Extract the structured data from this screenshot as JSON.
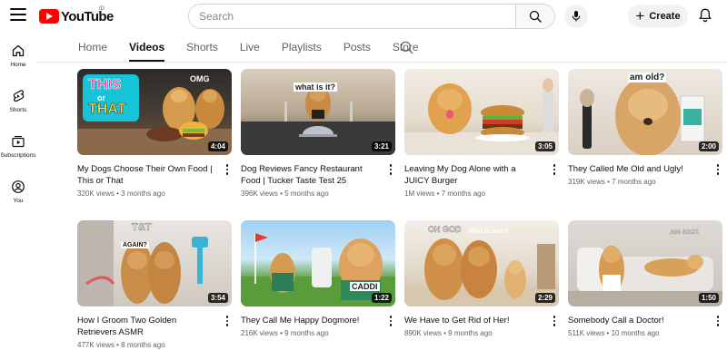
{
  "header": {
    "logo_text": "YouTube",
    "region": "ID",
    "search_placeholder": "Search",
    "create_label": "Create"
  },
  "sidebar": {
    "items": [
      {
        "label": "Home",
        "icon": "home-icon"
      },
      {
        "label": "Shorts",
        "icon": "shorts-icon"
      },
      {
        "label": "Subscriptions",
        "icon": "subscriptions-icon"
      },
      {
        "label": "You",
        "icon": "you-icon"
      }
    ]
  },
  "tabs": [
    "Home",
    "Videos",
    "Shorts",
    "Live",
    "Playlists",
    "Posts",
    "Store"
  ],
  "active_tab": "Videos",
  "videos": [
    {
      "title": "My Dogs Choose Their Own Food | This or That",
      "views": "320K views",
      "age": "3 months ago",
      "duration": "4:04",
      "overlay": [
        "THIS",
        "or",
        "THAT",
        "OMG"
      ]
    },
    {
      "title": "Dog Reviews Fancy Restaurant Food | Tucker Taste Test 25",
      "views": "396K views",
      "age": "5 months ago",
      "duration": "3:21",
      "overlay": [
        "what is it?"
      ]
    },
    {
      "title": "Leaving My Dog Alone with a JUICY Burger",
      "views": "1M views",
      "age": "7 months ago",
      "duration": "3:05",
      "overlay": []
    },
    {
      "title": "They Called Me Old and Ugly!",
      "views": "319K views",
      "age": "7 months ago",
      "duration": "2:00",
      "overlay": [
        "am old?"
      ]
    },
    {
      "title": "How I Groom Two Golden Retrievers ASMR",
      "views": "477K views",
      "age": "8 months ago",
      "duration": "3:54",
      "overlay": [
        "T&T",
        "AGAIN?"
      ]
    },
    {
      "title": "They Call Me Happy Dogmore!",
      "views": "216K views",
      "age": "9 months ago",
      "duration": "1:22",
      "overlay": [
        "CADDI"
      ]
    },
    {
      "title": "We Have to Get Rid of Her!",
      "views": "890K views",
      "age": "9 months ago",
      "duration": "2:29",
      "overlay": [
        "OH GOD",
        "Who is she?"
      ]
    },
    {
      "title": "Somebody Call a Doctor!",
      "views": "511K views",
      "age": "10 months ago",
      "duration": "1:50",
      "overlay": [
        "AM SICK"
      ]
    }
  ],
  "colors": {
    "brand_red": "#ff0000",
    "text_primary": "#0f0f0f",
    "text_secondary": "#606060"
  }
}
